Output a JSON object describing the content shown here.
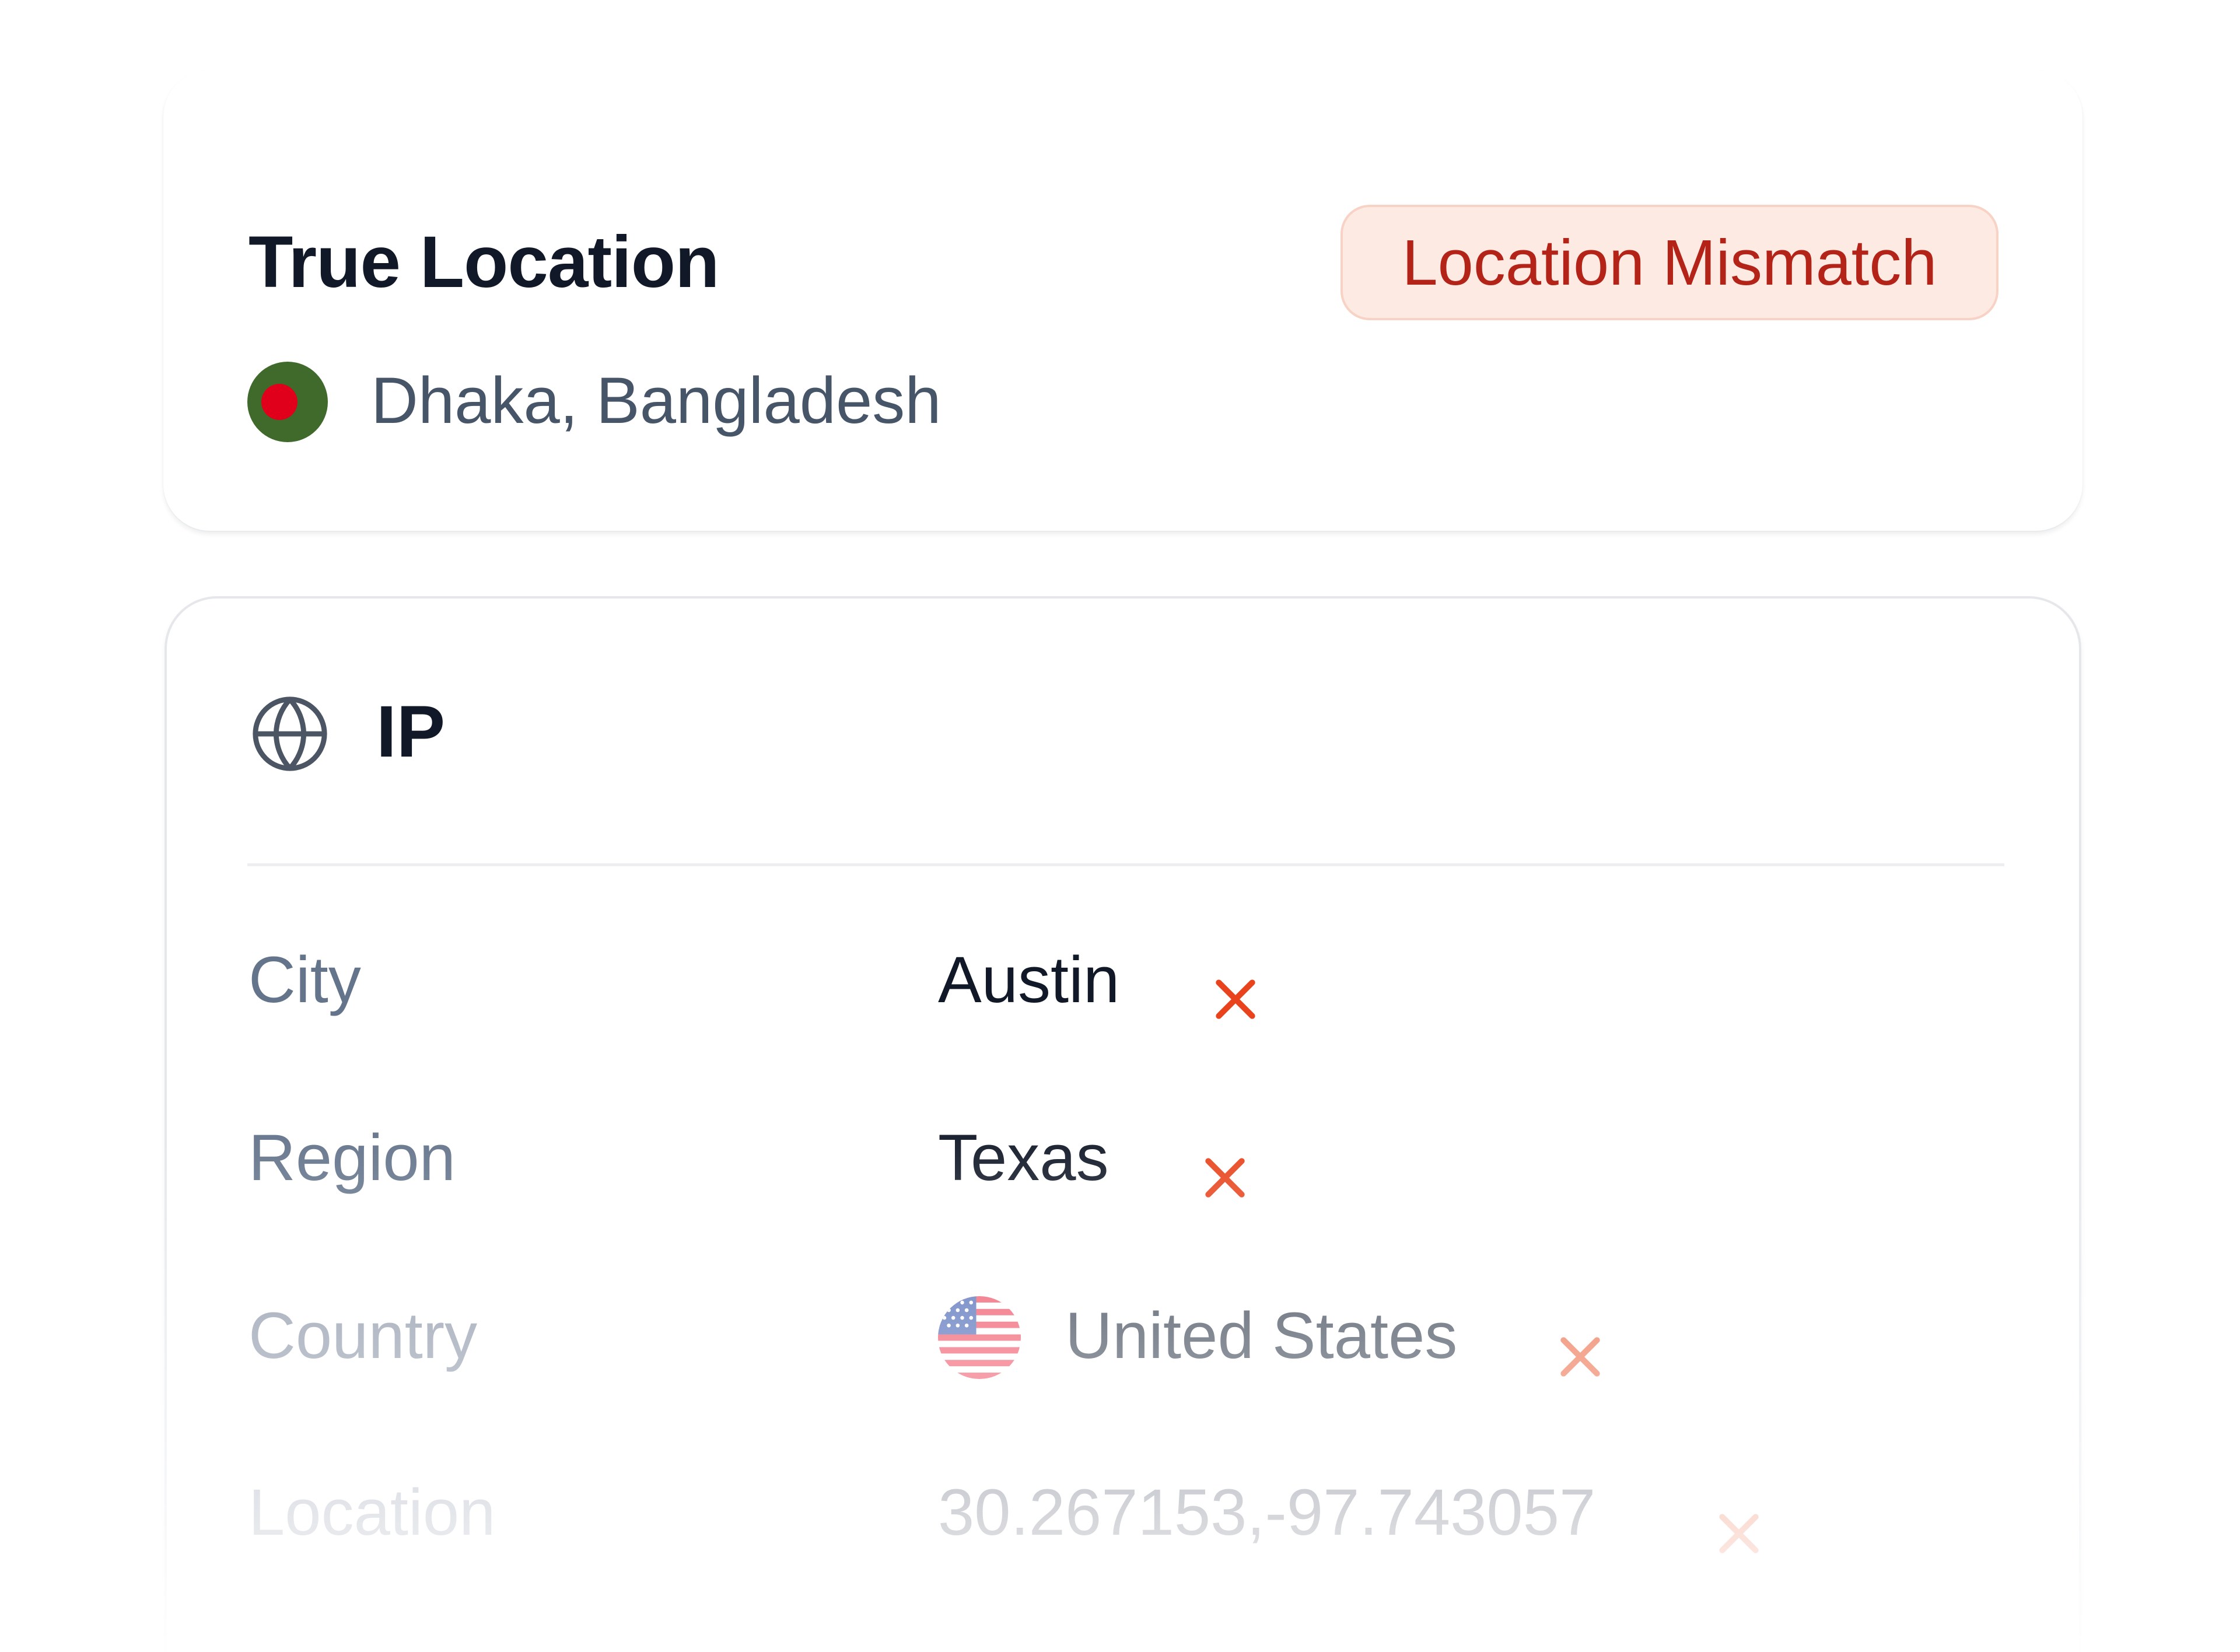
{
  "true_location": {
    "title": "True Location",
    "badge": "Location Mismatch",
    "place": "Dhaka, Bangladesh",
    "flag_icon": "bangladesh-flag-icon"
  },
  "ip": {
    "title": "IP",
    "icon": "globe-icon",
    "rows": [
      {
        "label": "City",
        "value": "Austin",
        "status_icon": "x-icon"
      },
      {
        "label": "Region",
        "value": "Texas",
        "status_icon": "x-icon"
      },
      {
        "label": "Country",
        "value": "United States",
        "flag_icon": "us-flag-icon",
        "status_icon": "x-icon"
      },
      {
        "label": "Location",
        "value": "30.267153,-97.743057",
        "status_icon": "x-icon"
      }
    ]
  },
  "colors": {
    "title_text": "#111827",
    "label_text": "#475569",
    "badge_background": "#fdeae3",
    "badge_text": "#b42318",
    "mismatch_icon": "#e8431c"
  }
}
